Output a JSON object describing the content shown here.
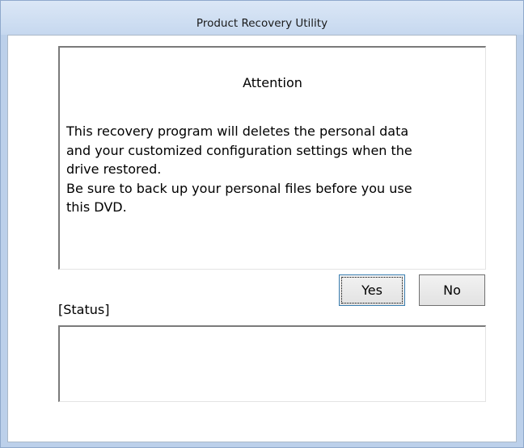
{
  "window": {
    "title": "Product Recovery Utility"
  },
  "dialog": {
    "heading": "Attention",
    "message": "This recovery program will deletes the personal data\nand your customized configuration settings when the\ndrive restored.\nBe sure to back up your personal files before you use\nthis DVD.",
    "buttons": {
      "yes_label": "Yes",
      "no_label": "No"
    }
  },
  "status": {
    "label": "[Status]",
    "text": ""
  }
}
